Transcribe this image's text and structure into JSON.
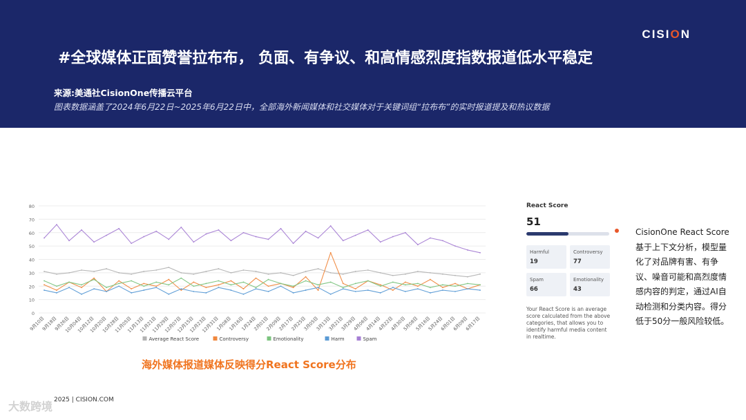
{
  "header": {
    "logo": "CISION",
    "title": "#全球媒体正面赞誉拉布布， 负面、有争议、和高情感烈度指数报道低水平稳定",
    "source": "来源:美通社CisionOne传播云平台",
    "note": "图表数据涵盖了2024年6月22日~2025年6月22日中，全部海外新闻媒体和社交媒体对于关键词组“拉布布”的实时报道提及和热议数据"
  },
  "chart_caption": "海外媒体报道媒体反映得分React Score分布",
  "score_card": {
    "label": "React Score",
    "value": "51",
    "fill": 0.51,
    "cells": [
      {
        "name": "Harmful",
        "value": "19"
      },
      {
        "name": "Controversy",
        "value": "77"
      },
      {
        "name": "Spam",
        "value": "66"
      },
      {
        "name": "Emotionality",
        "value": "43"
      }
    ],
    "description": "Your React Score is an average score calculated from the above categories, that allows you to identify harmful media content in realtime."
  },
  "explanation": "CisionOne React Score基于上下文分析，模型量化了对品牌有害、有争议、噪音可能和高烈度情感内容的判定，通过AI自动检测和分类内容。得分低于50分一般风险较低。",
  "footer": "2025 | CISION.COM",
  "watermark": "大数跨境",
  "colors": {
    "header_bg": "#1b2769",
    "accent": "#e8572a",
    "caption": "#f0741f"
  },
  "chart_data": {
    "type": "line",
    "ylim": [
      0,
      80
    ],
    "yticks": [
      0,
      10,
      20,
      30,
      40,
      50,
      60,
      70,
      80
    ],
    "xticks": [
      "9月10日",
      "9月18日",
      "9月26日",
      "10月04日",
      "10月12日",
      "10月20日",
      "10月28日",
      "11月05日",
      "11月13日",
      "11月21日",
      "11月29日",
      "12月07日",
      "12月15日",
      "12月23日",
      "12月31日",
      "1月08日",
      "1月16日",
      "1月24日",
      "2月01日",
      "2月09日",
      "2月17日",
      "2月25日",
      "3月05日",
      "3月13日",
      "3月21日",
      "3月29日",
      "4月06日",
      "4月14日",
      "4月22日",
      "4月30日",
      "5月08日",
      "5月16日",
      "5月24日",
      "6月01日",
      "6月09日",
      "6月17日"
    ],
    "series": [
      {
        "name": "Average React Score",
        "color": "#b3b3b3",
        "values": [
          31,
          29,
          30,
          32,
          31,
          33,
          30,
          29,
          31,
          32,
          34,
          30,
          29,
          31,
          33,
          30,
          32,
          31,
          29,
          30,
          28,
          31,
          33,
          30,
          29,
          31,
          32,
          30,
          28,
          29,
          31,
          30,
          29,
          28,
          27,
          29
        ]
      },
      {
        "name": "Controversy",
        "color": "#f0883e",
        "values": [
          21,
          17,
          23,
          19,
          26,
          16,
          24,
          18,
          22,
          20,
          25,
          17,
          23,
          19,
          21,
          24,
          18,
          26,
          20,
          22,
          19,
          27,
          17,
          45,
          22,
          18,
          24,
          21,
          17,
          23,
          20,
          25,
          19,
          22,
          18,
          21
        ]
      },
      {
        "name": "Emotionality",
        "color": "#7cc47f",
        "values": [
          24,
          20,
          23,
          21,
          25,
          19,
          22,
          24,
          20,
          23,
          21,
          26,
          20,
          22,
          24,
          21,
          23,
          19,
          25,
          22,
          20,
          24,
          21,
          23,
          19,
          22,
          24,
          20,
          23,
          21,
          22,
          19,
          21,
          20,
          22,
          21
        ]
      },
      {
        "name": "Harm",
        "color": "#5b9bd5",
        "values": [
          17,
          15,
          19,
          14,
          18,
          16,
          20,
          15,
          17,
          19,
          14,
          18,
          16,
          15,
          19,
          17,
          14,
          18,
          16,
          20,
          15,
          17,
          19,
          14,
          18,
          16,
          17,
          15,
          19,
          16,
          18,
          15,
          17,
          16,
          18,
          17
        ]
      },
      {
        "name": "Spam",
        "color": "#a67fd4",
        "values": [
          56,
          66,
          54,
          62,
          53,
          58,
          63,
          52,
          57,
          61,
          55,
          64,
          53,
          59,
          62,
          54,
          60,
          57,
          55,
          63,
          52,
          61,
          56,
          65,
          54,
          58,
          62,
          53,
          57,
          60,
          51,
          56,
          54,
          50,
          47,
          45
        ]
      }
    ]
  }
}
